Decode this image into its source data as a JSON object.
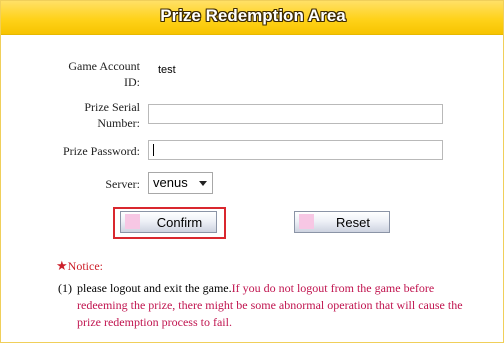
{
  "header": {
    "title": "Prize Redemption Area"
  },
  "form": {
    "account_label_1": "Game Account",
    "account_label_2": "ID:",
    "account_value": "test",
    "serial_label_1": "Prize Serial",
    "serial_label_2": "Number:",
    "serial_value": "",
    "password_label": "Prize Password:",
    "password_value": "",
    "server_label": "Server:",
    "server_value": "venus"
  },
  "buttons": {
    "confirm": "Confirm",
    "reset": "Reset"
  },
  "notice": {
    "star": "★",
    "title": "Notice:",
    "number": "(1)",
    "text_black": "please logout and exit the game.",
    "text_red": "If you do not logout from the game before redeeming the prize, there might be some abnormal operation that will cause the prize redemption process to fail."
  },
  "colors": {
    "header_gold": "#ffd21a",
    "notice_red": "#cc1f2a",
    "highlight_red": "#d9272e",
    "button_square": "#f7c7e4"
  }
}
